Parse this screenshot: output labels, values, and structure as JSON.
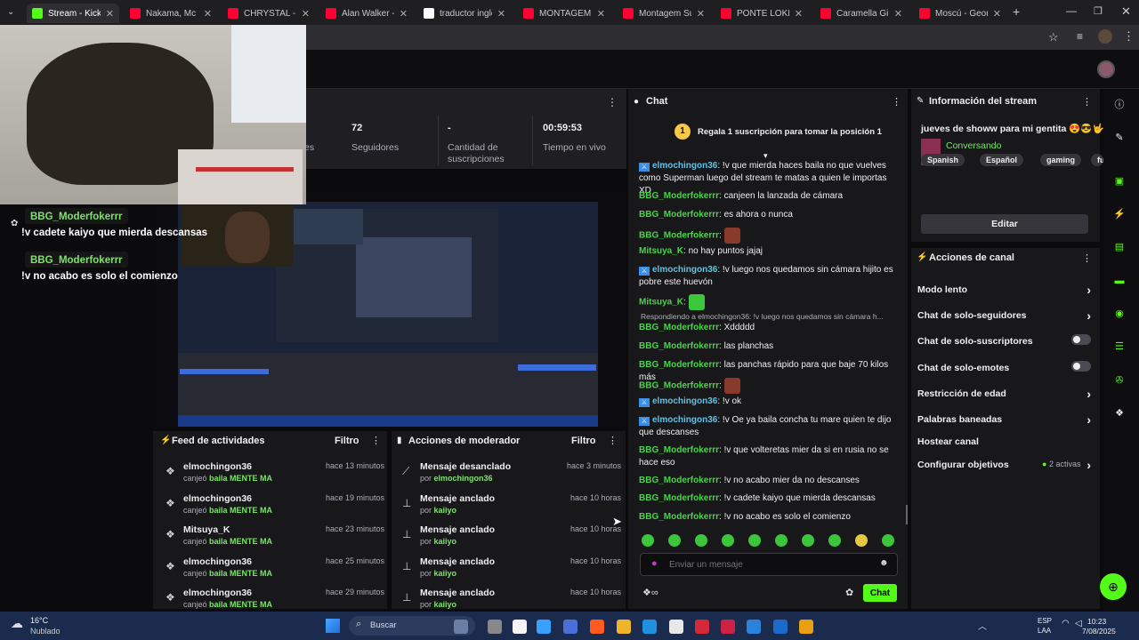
{
  "tabs": [
    {
      "label": "Stream - Kick Da",
      "color": "#53fc18"
    },
    {
      "label": "Nakama, Mc Sta",
      "color": "#ff0033"
    },
    {
      "label": "CHRYSTAL - THE",
      "color": "#ff0033"
    },
    {
      "label": "Alan Walker - Sin",
      "color": "#ff0033"
    },
    {
      "label": "traductor ingles",
      "color": "#ffffff"
    },
    {
      "label": "MONTAGEM XO",
      "color": "#ff0033"
    },
    {
      "label": "Montagem Supe",
      "color": "#ff0033"
    },
    {
      "label": "PONTE LOKITA",
      "color": "#ff0033"
    },
    {
      "label": "Caramella Girls",
      "color": "#ff0033"
    },
    {
      "label": "Moscú - Georgie",
      "color": "#ff0033"
    }
  ],
  "stats": {
    "cut_label": "es",
    "followers_value": "72",
    "followers_label": "Seguidores",
    "subs_value": "-",
    "subs_label": "Cantidad de suscripciones",
    "live_value": "00:59:53",
    "live_label": "Tiempo en vivo"
  },
  "overlay": {
    "user1": "BBG_Moderfokerrr",
    "msg1": "!v cadete kaiyo que mierda descansas",
    "user2": "BBG_Moderfokerrr",
    "msg2": "!v no acabo es solo el comienzo"
  },
  "feed": {
    "title": "Feed de actividades",
    "filter": "Filtro",
    "items": [
      {
        "name": "elmochingon36",
        "sub_prefix": "canjeó",
        "sub_reward": "baila MENTE MA",
        "time": "hace 13 minutos"
      },
      {
        "name": "elmochingon36",
        "sub_prefix": "canjeó",
        "sub_reward": "baila MENTE MA",
        "time": "hace 19 minutos"
      },
      {
        "name": "Mitsuya_K",
        "sub_prefix": "canjeó",
        "sub_reward": "baila MENTE MA",
        "time": "hace 23 minutos"
      },
      {
        "name": "elmochingon36",
        "sub_prefix": "canjeó",
        "sub_reward": "baila MENTE MA",
        "time": "hace 25 minutos"
      },
      {
        "name": "elmochingon36",
        "sub_prefix": "canjeó",
        "sub_reward": "baila MENTE MA",
        "time": "hace 29 minutos"
      }
    ]
  },
  "mod": {
    "title": "Acciones de moderador",
    "filter": "Filtro",
    "items": [
      {
        "name": "Mensaje desanclado",
        "sub_prefix": "por",
        "sub_user": "elmochingon36",
        "time": "hace 3 minutos"
      },
      {
        "name": "Mensaje anclado",
        "sub_prefix": "por",
        "sub_user": "kaiiyo",
        "time": "hace 10 horas"
      },
      {
        "name": "Mensaje anclado",
        "sub_prefix": "por",
        "sub_user": "kaiiyo",
        "time": "hace 10 horas"
      },
      {
        "name": "Mensaje anclado",
        "sub_prefix": "por",
        "sub_user": "kaiiyo",
        "time": "hace 10 horas"
      },
      {
        "name": "Mensaje anclado",
        "sub_prefix": "por",
        "sub_user": "kaiiyo",
        "time": "hace 10 horas"
      }
    ]
  },
  "chat": {
    "title": "Chat",
    "pinned_rank": "1",
    "pinned_text": "Regala 1 suscripción para tomar la posición 1",
    "reply_text": "Respondiendo a elmochingon36: !v luego nos quedamos sin cámara h...",
    "messages": [
      {
        "user": "elmochingon36",
        "text": "!v que mierda haces baila no que vuelves como Superman luego del stream te matas a quien le importas XD",
        "mod": true
      },
      {
        "user": "BBG_Moderfokerrr",
        "text": "canjeen la lanzada de cámara",
        "mod": false
      },
      {
        "user": "BBG_Moderfokerrr",
        "text": "es ahora o nunca",
        "mod": false
      },
      {
        "user": "BBG_Moderfokerrr",
        "text": "",
        "mod": false
      },
      {
        "user": "Mitsuya_K",
        "text": "no hay puntos jajaj",
        "mod": false
      },
      {
        "user": "elmochingon36",
        "text": "!v luego nos quedamos sin cámara hijito es pobre este huevón",
        "mod": true
      },
      {
        "user": "Mitsuya_K",
        "text": "",
        "mod": false
      },
      {
        "user": "BBG_Moderfokerrr",
        "text": "Xddddd",
        "mod": false
      },
      {
        "user": "BBG_Moderfokerrr",
        "text": "las planchas",
        "mod": false
      },
      {
        "user": "BBG_Moderfokerrr",
        "text": "las panchas rápido para que baje 70 kilos más",
        "mod": false
      },
      {
        "user": "BBG_Moderfokerrr",
        "text": "",
        "mod": false
      },
      {
        "user": "elmochingon36",
        "text": "!v ok",
        "mod": true
      },
      {
        "user": "elmochingon36",
        "text": "!v Oe ya baila concha tu mare quien te dijo que descanses",
        "mod": true
      },
      {
        "user": "BBG_Moderfokerrr",
        "text": "!v que volteretas mier da si en rusia no se hace eso",
        "mod": false
      },
      {
        "user": "BBG_Moderfokerrr",
        "text": "!v no acabo mier da no descanses",
        "mod": false
      },
      {
        "user": "BBG_Moderfokerrr",
        "text": "!v cadete kaiyo que mierda descansas",
        "mod": false
      },
      {
        "user": "BBG_Moderfokerrr",
        "text": "!v no acabo es solo el comienzo",
        "mod": false
      }
    ],
    "input_placeholder": "Enviar un mensaje",
    "send_label": "Chat"
  },
  "info": {
    "title": "Información del stream",
    "stream_title": "jueves de showw para mi gentita 😍😎🤟",
    "category": "Conversando",
    "tags": [
      "Spanish",
      "Español",
      "gaming",
      "funn"
    ],
    "edit_label": "Editar"
  },
  "actions": {
    "title": "Acciones de canal",
    "slow": "Modo lento",
    "followers_only": "Chat de solo-seguidores",
    "subs_only": "Chat de solo-suscriptores",
    "emotes_only": "Chat de solo-emotes",
    "age": "Restricción de edad",
    "banned": "Palabras baneadas",
    "host": "Hostear canal",
    "goals": "Configurar objetivos",
    "goals_badge": "2 activas"
  },
  "taskbar": {
    "temp": "16°C",
    "weather": "Nublado",
    "search": "Buscar",
    "lang1": "ESP",
    "lang2": "LAA",
    "time": "10:23",
    "date": "7/08/2025"
  }
}
